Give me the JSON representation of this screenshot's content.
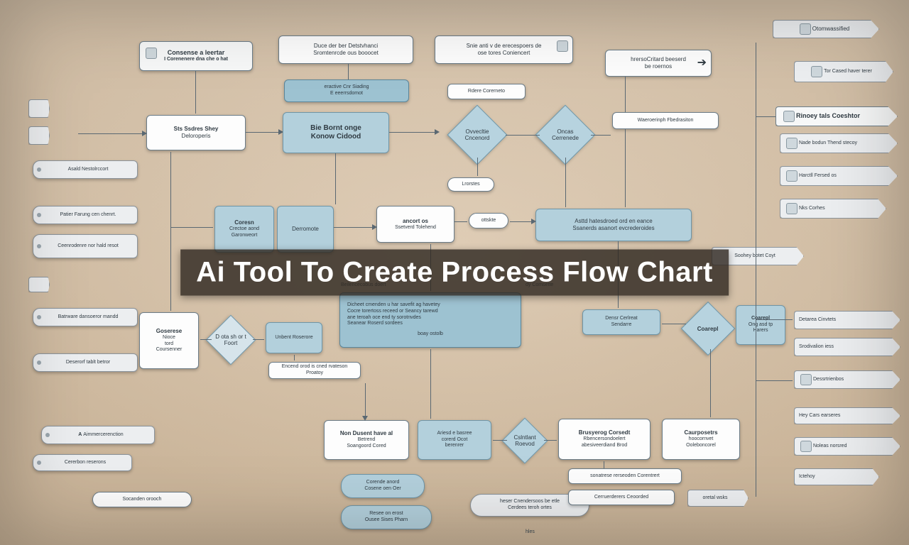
{
  "title_banner": "Ai Tool To Create Process Flow Chart",
  "top_row": {
    "card_a": {
      "title": "Consense a leertar",
      "sub": "I Corenenere dna che o hat"
    },
    "card_b": {
      "line1": "Duce der ber Detstvhanci",
      "line2": "Sromtenrcde ous booocet"
    },
    "card_c": {
      "line1": "Snie anti v de erecespoers de",
      "line2": "ose tores Coniencert"
    },
    "card_d": {
      "line1": "hrersoCritard beeserd",
      "line2": "be roernos"
    },
    "prompt": "Otomwassified",
    "right_tag": "Tor Cased haver terer"
  },
  "left_column": {
    "item1": "Asald Nestolrccort",
    "item2": "Patier Farung cen chenrt.",
    "item3": "Ceenrodenre nor hald resot",
    "item4": "Batrware dansoeror mandd",
    "item5": "Deserorf tablt betror",
    "item6": "Aimmercerenction",
    "item7": "Cererbon reserons",
    "pill": "Socanden orooch"
  },
  "main": {
    "step1": {
      "title": "Sts Ssdres Shey",
      "sub": "Deloroperis"
    },
    "step2": {
      "title": "Bie Bornt onge",
      "sub": "Konow Cidood"
    },
    "between_bar": {
      "line1": "eractive Cnr Siading",
      "line2": "E eeerrsdomot"
    },
    "mini_label": "Rdere Corerneto",
    "decision1": "Ovvecltie Cncenord",
    "decision2": "Oncas Cerrenede",
    "cloud_label": "Lrorstes",
    "process_group": {
      "p1": {
        "title": "Coresn",
        "sub1": "Crectoe aond",
        "sub2": "Garonweort"
      },
      "p2": "Derromote",
      "p3": {
        "title": "ancort os",
        "sub1": "Ssetverd Tolehend"
      },
      "pill": "ottskte",
      "p4": {
        "line1": "Asttd hatesdroed ord en eance",
        "line2": "Ssanerds asanort evcrederoides"
      }
    },
    "tiny_labels": [
      "Beilencecobus doert",
      "dy Comsette"
    ],
    "mid_block": {
      "lines": [
        "Dicheet cmenden u har savefit ag havetey",
        "Cocre torertoss receed or Seancy tarewd",
        "ane teroah oce end ty sorotnvdes",
        "Seanear Roserd sordees"
      ],
      "footer": "boay ostolb"
    },
    "lower_left": {
      "g1": {
        "title": "Goserese",
        "sub1": "Nioce",
        "sub2": "tord",
        "sub3": "Coursenner"
      },
      "d1": "D ota sh or t Foort",
      "u1": "Unbent Roserore",
      "note": "Encend orod is cned rvateson Proatoy"
    },
    "lower_mid": {
      "m1": {
        "title": "Non Dusent have al",
        "sub1": "Betrend",
        "sub2": "Soangoord Cored"
      },
      "m2": {
        "line1": "Ariesd e basree",
        "line2": "corerd Ocot",
        "line3": "berenrer"
      },
      "m3": "Cslntlant Roevod",
      "sub_a": {
        "line1": "Corende anord",
        "line2": "Cosene oen Oer"
      },
      "sub_b": {
        "line1": "Resee on erost",
        "line2": "Ousee Sises Pharn"
      },
      "pill2": {
        "line1": "heser Cnendersoos be etle",
        "line2": "Cerdees teroh ortes"
      },
      "tiny": "hles"
    },
    "lower_right": {
      "r1": {
        "title": "Brusyerog Corsedt",
        "sub1": "Rbencersondoelert",
        "sub2": "abesiveerdiand Brod"
      },
      "r2": {
        "title": "Caurposetrs",
        "sub1": "hoocornvet",
        "sub2": "Ooleboncorel"
      },
      "r3": "sonatrese rerseoden Corentrert",
      "r4": "Cerruerderers Ceoorded",
      "tag": "oretal wsks"
    },
    "right_upper": {
      "n1": "Waeroerinph Fbedrasiton",
      "n2": {
        "line1": "Densr Cerlreat",
        "line2": "Sendarre"
      },
      "n3": {
        "title": "Coarepl",
        "sub1": "Ong asd tp",
        "sub2": "Harers"
      }
    }
  },
  "right_column": {
    "header1": "Rinoey tals Coeshtor",
    "r1": "Nade bodun Thend stecoy",
    "r2": "Harctll Fersed os",
    "r3": "Nks Corhes",
    "r4": "Soohey botet Coyt",
    "list": [
      "Detarea Cinvtets",
      "Srodivalion iess",
      "Dessrtrienbos",
      "Hey Cars earseres",
      "Noleas norsred",
      "Ictehoy"
    ]
  }
}
